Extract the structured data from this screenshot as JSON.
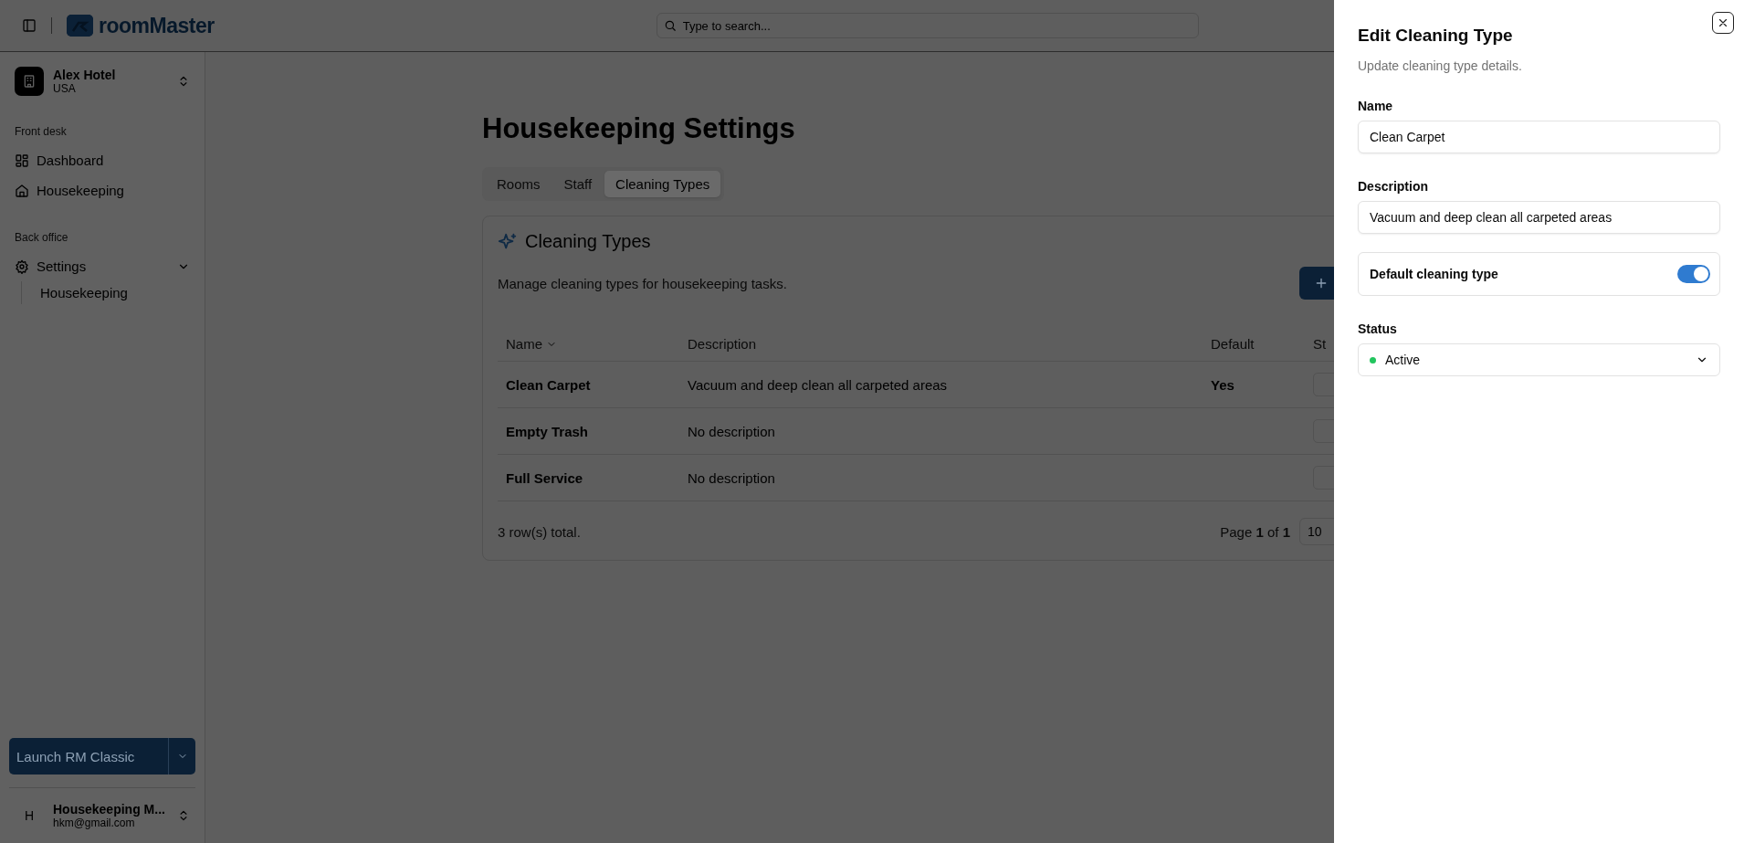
{
  "header": {
    "logo": "roomMaster",
    "search": {
      "placeholder": "Type to search..."
    }
  },
  "sidebar": {
    "property": {
      "name": "Alex Hotel",
      "country": "USA"
    },
    "sections": [
      {
        "title": "Front desk",
        "items": [
          {
            "label": "Dashboard"
          },
          {
            "label": "Housekeeping"
          }
        ]
      },
      {
        "title": "Back office",
        "items": [
          {
            "label": "Settings",
            "expanded": true,
            "children": [
              {
                "label": "Housekeeping"
              }
            ]
          }
        ]
      }
    ],
    "launch_button": {
      "label": "Launch RM Classic"
    },
    "user": {
      "initial": "H",
      "name": "Housekeeping M...",
      "email": "hkm@gmail.com"
    }
  },
  "main": {
    "title": "Housekeeping Settings",
    "tabs": [
      {
        "label": "Rooms",
        "selected": false
      },
      {
        "label": "Staff",
        "selected": false
      },
      {
        "label": "Cleaning Types",
        "selected": true
      }
    ],
    "card": {
      "title": "Cleaning Types",
      "description": "Manage cleaning types for housekeeping tasks.",
      "table": {
        "columns": [
          "Name",
          "Description",
          "Default",
          "St"
        ],
        "rows": [
          {
            "name": "Clean Carpet",
            "description": "Vacuum and deep clean all carpeted areas",
            "default": "Yes"
          },
          {
            "name": "Empty Trash",
            "description": "No description"
          },
          {
            "name": "Full Service",
            "description": "No description"
          }
        ]
      },
      "footer": {
        "total": "3 row(s) total.",
        "page": "Page **1** of **1**",
        "page_size": "10"
      }
    }
  },
  "sheet": {
    "title": "Edit Cleaning Type",
    "subtitle": "Update cleaning type details.",
    "fields": [
      {
        "kind": "text",
        "label": "Name",
        "value": "Clean Carpet"
      },
      {
        "kind": "text",
        "label": "Description",
        "value": "Vacuum and deep clean all carpeted areas"
      },
      {
        "kind": "switch",
        "label": "Default cleaning type",
        "on": true
      },
      {
        "kind": "select",
        "label": "Status",
        "value": "Active",
        "color": "#22c55e"
      }
    ]
  }
}
